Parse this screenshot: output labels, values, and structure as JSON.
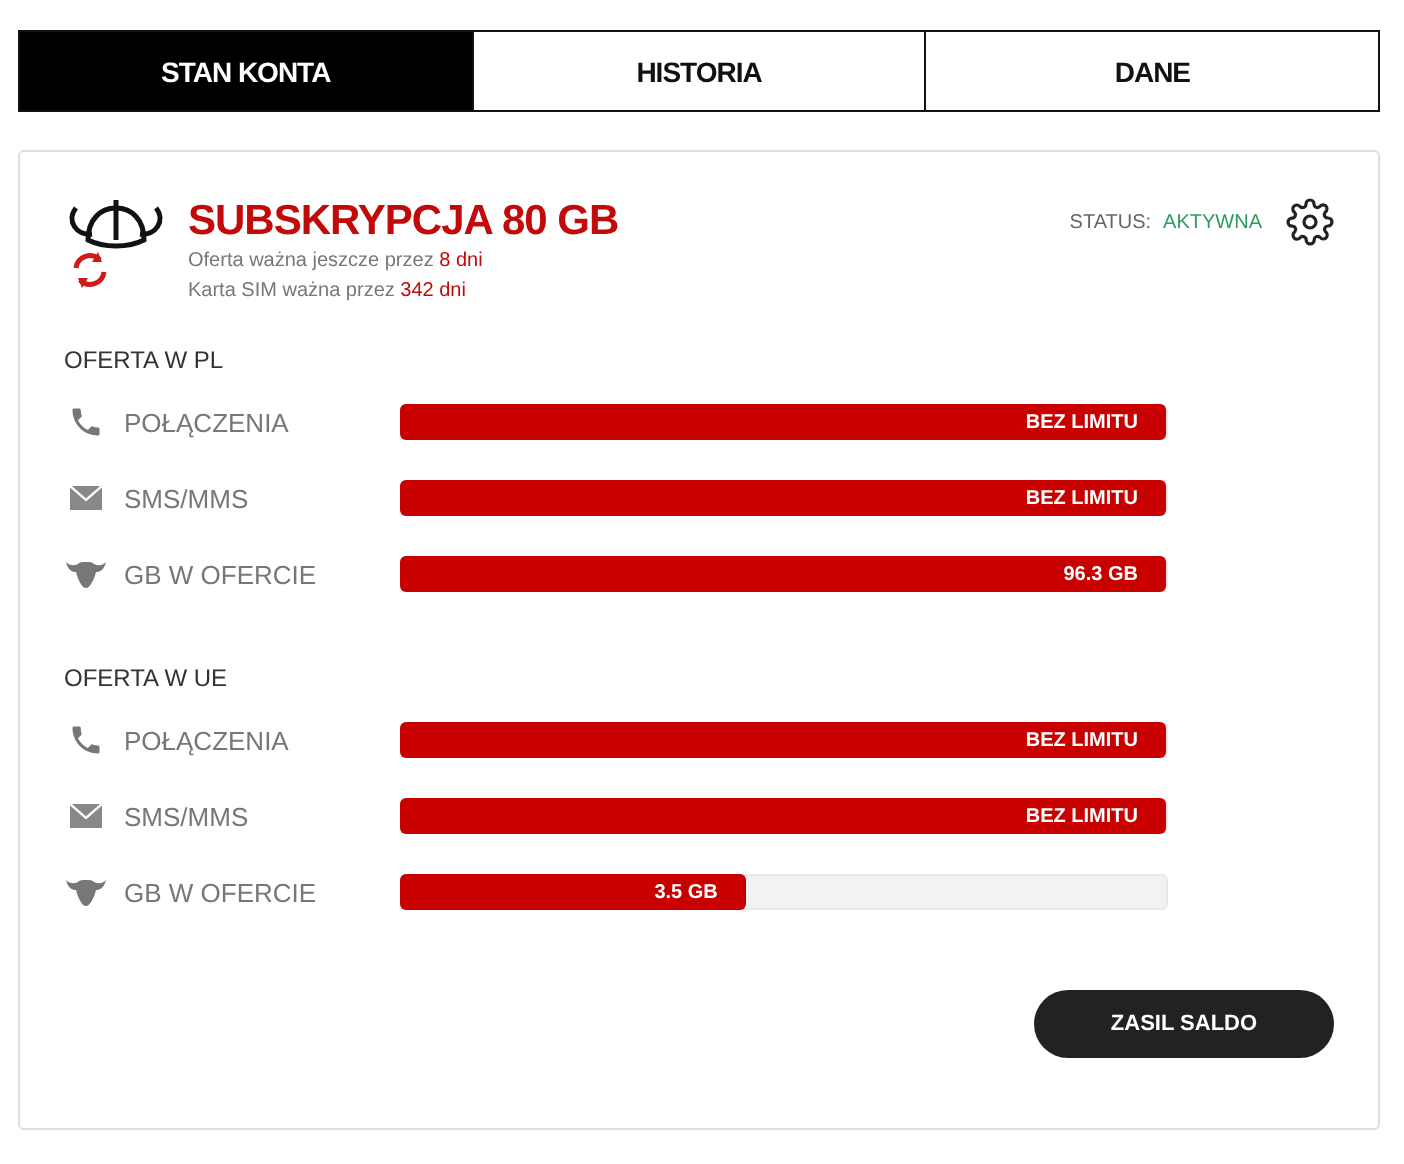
{
  "tabs": [
    {
      "label": "STAN KONTA",
      "selected": true
    },
    {
      "label": "HISTORIA",
      "selected": false
    },
    {
      "label": "DANE",
      "selected": false
    }
  ],
  "plan": {
    "title": "SUBSKRYPCJA 80 GB",
    "offer_valid": "Oferta ważna jeszcze przez **8 dni**",
    "sim_valid": "Karta SIM ważna przez **342 dni**",
    "status_label": "STATUS:",
    "status_value": "AKTYWNA"
  },
  "sections": [
    {
      "title": "OFERTA W PL",
      "rows": [
        {
          "kind": "calls",
          "label": "POŁĄCZENIA",
          "level": 1,
          "reading": "BEZ LIMITU"
        },
        {
          "kind": "sms",
          "label": "SMS/MMS",
          "level": 1,
          "reading": "BEZ LIMITU"
        },
        {
          "kind": "data",
          "label": "GB W OFERCIE",
          "level": 1,
          "reading": "96.3 GB"
        }
      ]
    },
    {
      "title": "OFERTA W UE",
      "rows": [
        {
          "kind": "calls",
          "label": "POŁĄCZENIA",
          "level": 1,
          "reading": "BEZ LIMITU"
        },
        {
          "kind": "sms",
          "label": "SMS/MMS",
          "level": 1,
          "reading": "BEZ LIMITU"
        },
        {
          "kind": "data",
          "label": "GB W OFERCIE",
          "level": 0.45,
          "reading": "3.5 GB"
        }
      ]
    }
  ],
  "button": "ZASIL SALDO"
}
